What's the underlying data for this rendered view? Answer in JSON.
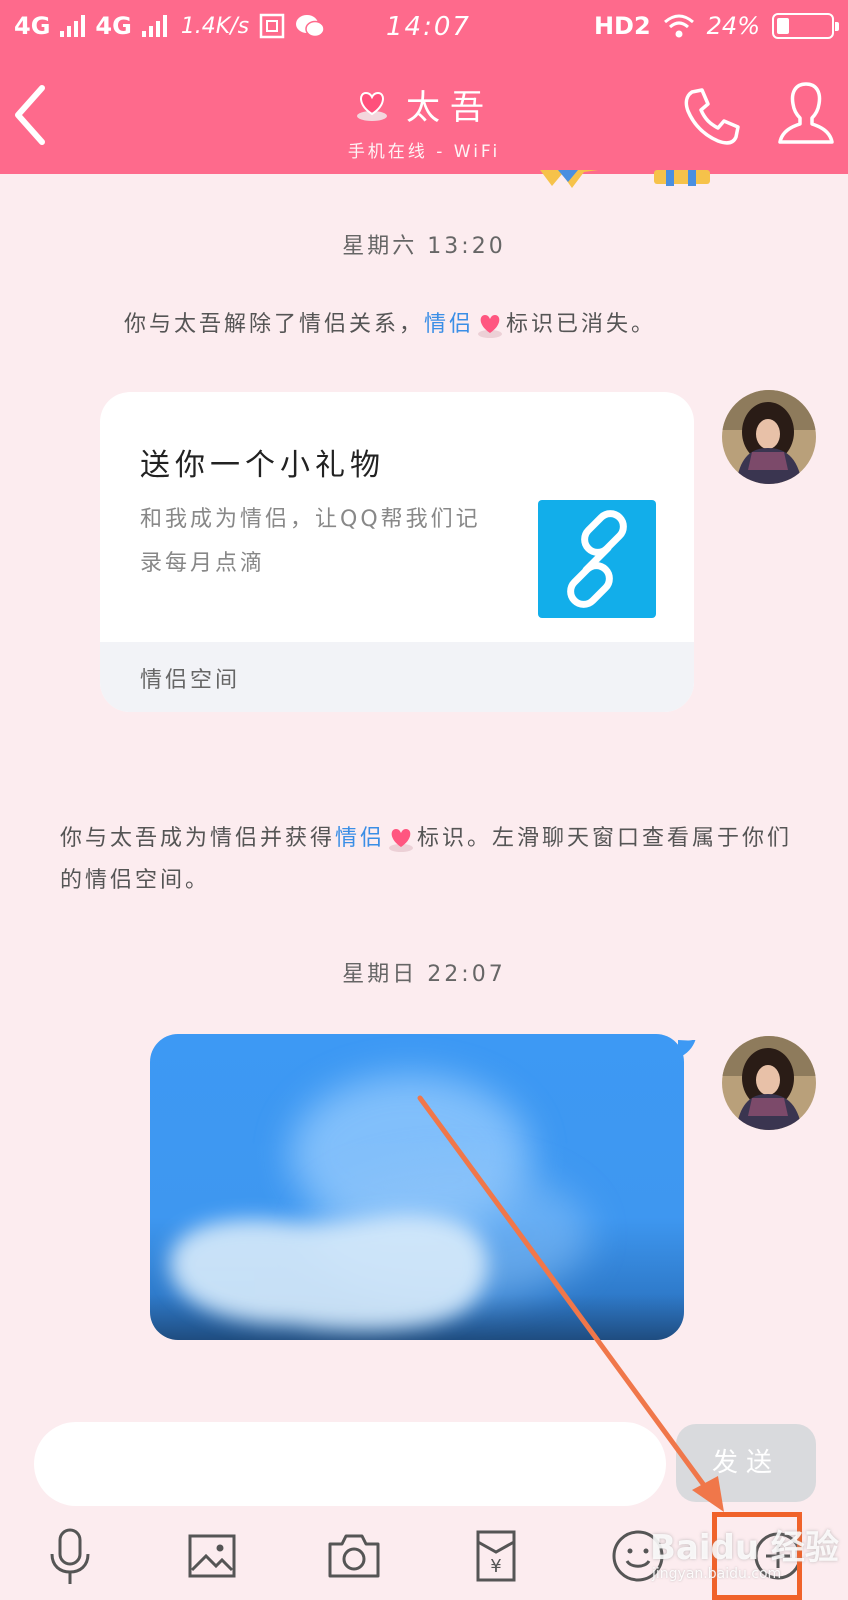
{
  "status_bar": {
    "network1": "4G",
    "network2": "4G",
    "speed": "1.4K/s",
    "time": "14:07",
    "hd": "HD2",
    "battery": "24%",
    "battery_level": 0.24
  },
  "header": {
    "title": "太吾",
    "subtitle": "手机在线 - WiFi"
  },
  "messages": {
    "timestamp1": "星期六 13:20",
    "sys1_before": "你与太吾解除了情侣关系，",
    "sys1_link": "情侣",
    "sys1_after": "标识已消失。",
    "gift_title": "送你一个小礼物",
    "gift_desc": "和我成为情侣，让QQ帮我们记录每月点滴",
    "gift_footer": "情侣空间",
    "sys2_before": "你与太吾成为情侣并获得",
    "sys2_link": "情侣",
    "sys2_after": "标识。左滑聊天窗口查看属于你们的情侣空间。",
    "timestamp2": "星期日 22:07"
  },
  "input": {
    "placeholder": "",
    "send_label": "发送"
  },
  "watermark": {
    "brand": "Baidu 经验",
    "url": "jingyan.baidu.com"
  },
  "colors": {
    "header_bg": "#fe6a8c",
    "chat_bg": "#fcecef",
    "link": "#3a8ee6",
    "annotation": "#f0622a"
  }
}
